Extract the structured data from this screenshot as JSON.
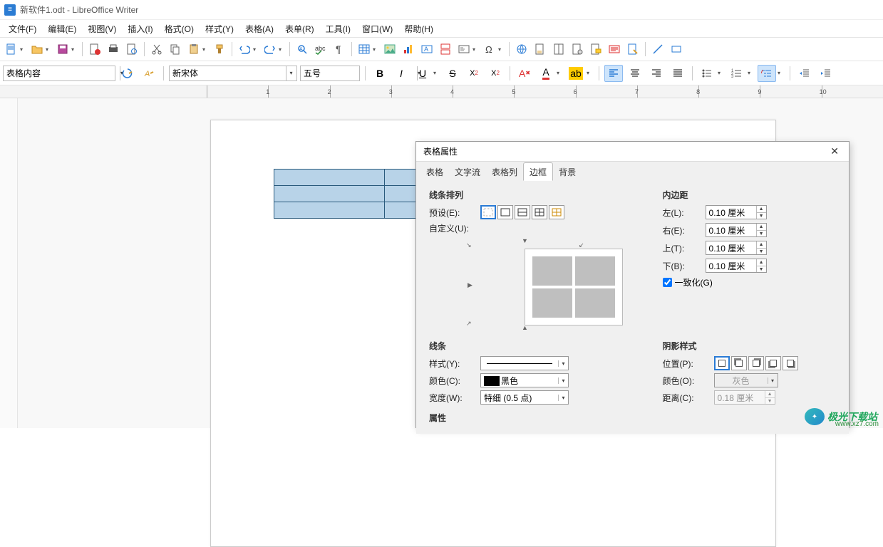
{
  "title": "新软件1.odt - LibreOffice Writer",
  "menu": {
    "file": "文件(F)",
    "edit": "编辑(E)",
    "view": "视图(V)",
    "insert": "插入(I)",
    "format": "格式(O)",
    "styles": "样式(Y)",
    "table": "表格(A)",
    "form": "表单(R)",
    "tools": "工具(I)",
    "window": "窗口(W)",
    "help": "帮助(H)"
  },
  "format": {
    "paraStyle": "表格内容",
    "font": "新宋体",
    "size": "五号"
  },
  "ruler": [
    "1",
    "2",
    "3",
    "4",
    "5",
    "6",
    "7",
    "8",
    "9",
    "10"
  ],
  "dialog": {
    "title": "表格属性",
    "tabs": {
      "table": "表格",
      "textflow": "文字流",
      "columns": "表格列",
      "borders": "边框",
      "background": "背景"
    },
    "sections": {
      "lineArr": "线条排列",
      "line": "线条",
      "padding": "内边距",
      "shadow": "阴影样式",
      "attr": "属性"
    },
    "labels": {
      "preset": "预设(E):",
      "custom": "自定义(U):",
      "style": "样式(Y):",
      "color": "颜色(C):",
      "width": "宽度(W):",
      "left": "左(L):",
      "right": "右(E):",
      "top": "上(T):",
      "bottom": "下(B):",
      "uniform": "一致化(G)",
      "position": "位置(P):",
      "shColor": "颜色(O):",
      "distance": "距离(C):"
    },
    "values": {
      "pad": "0.10 厘米",
      "lineColor": "黑色",
      "lineWidth": "特细 (0.5 点)",
      "shadowColor": "灰色",
      "shadowDist": "0.18 厘米"
    }
  },
  "watermark": {
    "text": "极光下载站",
    "url": "www.xz7.com"
  }
}
